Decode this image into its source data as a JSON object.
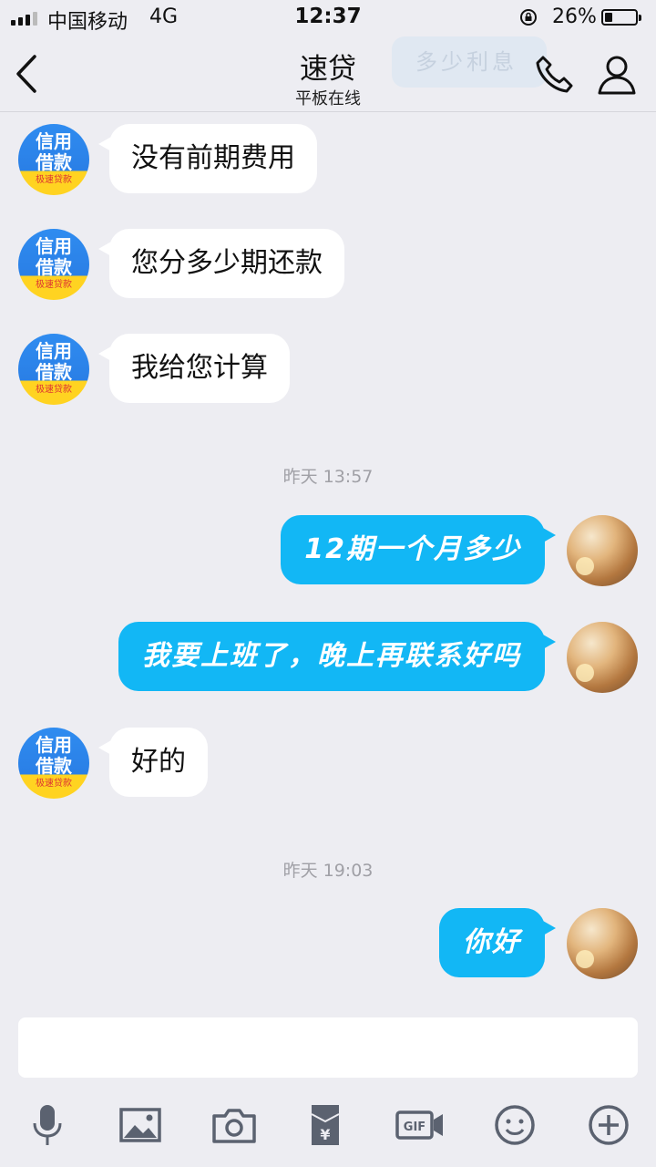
{
  "status_bar": {
    "carrier": "中国移动",
    "network": "4G",
    "time": "12:37",
    "battery_percent_text": "26%",
    "battery_level": 0.26
  },
  "header": {
    "title": "速贷",
    "subtitle": "平板在线",
    "ghost_preview": "多少利息"
  },
  "contact_avatar": {
    "line1": "信用",
    "line2": "借款",
    "line3": "极速贷款"
  },
  "messages": [
    {
      "from": "contact",
      "text": "没有前期费用"
    },
    {
      "from": "contact",
      "text": "您分多少期还款"
    },
    {
      "from": "contact",
      "text": "我给您计算"
    },
    {
      "type": "timestamp",
      "text": "昨天 13:57"
    },
    {
      "from": "me",
      "text": "12期一个月多少"
    },
    {
      "from": "me",
      "text": "我要上班了，晚上再联系好吗"
    },
    {
      "from": "contact",
      "text": "好的"
    },
    {
      "type": "timestamp",
      "text": "昨天 19:03"
    },
    {
      "from": "me",
      "text": "你好"
    }
  ],
  "input": {
    "value": ""
  },
  "toolbar": {
    "items": [
      "mic-icon",
      "image-icon",
      "camera-icon",
      "red-packet-icon",
      "gif-icon",
      "emoji-icon",
      "plus-icon"
    ],
    "gif_label": "GIF",
    "red_packet_symbol": "¥"
  },
  "colors": {
    "background": "#ededf2",
    "outgoing_bubble": "#12b7f5",
    "incoming_bubble": "#ffffff",
    "timestamp": "#a0a0a6"
  }
}
